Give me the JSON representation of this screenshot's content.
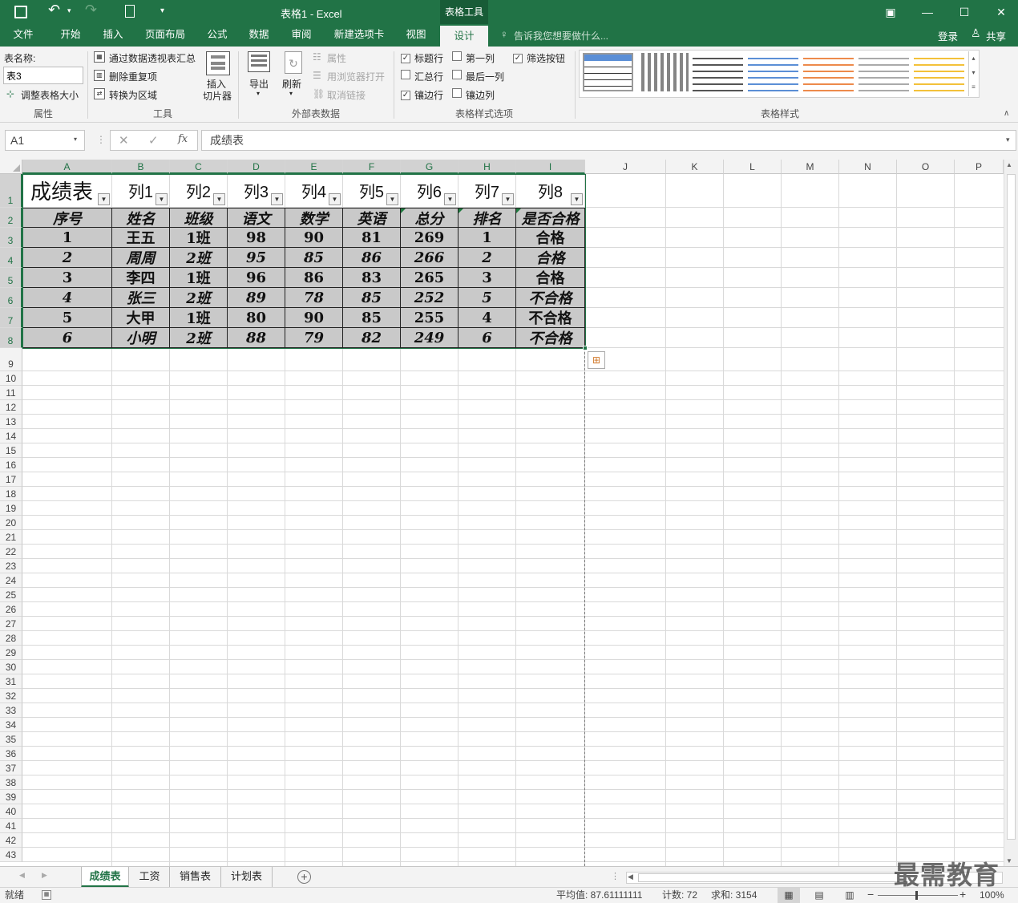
{
  "titlebar": {
    "title": "表格1 - Excel",
    "context_tab": "表格工具",
    "qat_more": "▾"
  },
  "tabs": [
    "文件",
    "开始",
    "插入",
    "页面布局",
    "公式",
    "数据",
    "审阅",
    "新建选项卡",
    "视图",
    "设计"
  ],
  "tell_me": "告诉我您想要做什么...",
  "account": {
    "login": "登录",
    "share": "共享"
  },
  "ribbon": {
    "table_name_label": "表名称:",
    "table_name_value": "表3",
    "resize_table": "调整表格大小",
    "group_properties": "属性",
    "summarize_pivot": "通过数据透视表汇总",
    "remove_duplicates": "删除重复项",
    "convert_to_range": "转换为区域",
    "insert_slicer_1": "插入",
    "insert_slicer_2": "切片器",
    "group_tools": "工具",
    "export": "导出",
    "refresh": "刷新",
    "properties": "属性",
    "open_browser": "用浏览器打开",
    "unlink": "取消链接",
    "group_external": "外部表数据",
    "opt_header_row": "标题行",
    "opt_total_row": "汇总行",
    "opt_banded_rows": "镶边行",
    "opt_first_col": "第一列",
    "opt_last_col": "最后一列",
    "opt_banded_cols": "镶边列",
    "opt_filter_btn": "筛选按钮",
    "group_style_options": "表格样式选项",
    "group_styles": "表格样式"
  },
  "formula": {
    "namebox": "A1",
    "fx": "fx",
    "value": "成绩表"
  },
  "columns": [
    "A",
    "B",
    "C",
    "D",
    "E",
    "F",
    "G",
    "H",
    "I",
    "J",
    "K",
    "L",
    "M",
    "N",
    "O",
    "P"
  ],
  "rows": [
    "1",
    "2",
    "3",
    "4",
    "5",
    "6",
    "7",
    "8",
    "9",
    "10",
    "11",
    "12",
    "13",
    "14",
    "15",
    "16",
    "17",
    "18",
    "19",
    "20",
    "21",
    "22",
    "23",
    "24",
    "25",
    "26",
    "27",
    "28",
    "29",
    "30",
    "31",
    "32",
    "33",
    "34",
    "35",
    "36",
    "37",
    "38",
    "39",
    "40",
    "41",
    "42",
    "43"
  ],
  "table": {
    "header_row": [
      "成绩表",
      "列1",
      "列2",
      "列3",
      "列4",
      "列5",
      "列6",
      "列7",
      "列8"
    ],
    "data": [
      [
        "序号",
        "姓名",
        "班级",
        "语文",
        "数学",
        "英语",
        "总分",
        "排名",
        "是否合格"
      ],
      [
        "1",
        "王五",
        "1班",
        "98",
        "90",
        "81",
        "269",
        "1",
        "合格"
      ],
      [
        "2",
        "周周",
        "2班",
        "95",
        "85",
        "86",
        "266",
        "2",
        "合格"
      ],
      [
        "3",
        "李四",
        "1班",
        "96",
        "86",
        "83",
        "265",
        "3",
        "合格"
      ],
      [
        "4",
        "张三",
        "2班",
        "89",
        "78",
        "85",
        "252",
        "5",
        "不合格"
      ],
      [
        "5",
        "大甲",
        "1班",
        "80",
        "90",
        "85",
        "255",
        "4",
        "不合格"
      ],
      [
        "6",
        "小明",
        "2班",
        "88",
        "79",
        "82",
        "249",
        "6",
        "不合格"
      ]
    ]
  },
  "sheets": [
    "成绩表",
    "工资",
    "销售表",
    "计划表"
  ],
  "status": {
    "ready": "就绪",
    "average": "平均值: 87.61111111",
    "count": "计数: 72",
    "sum": "求和: 3154",
    "zoom": "100%"
  },
  "watermark": "最需教育",
  "colors": {
    "excel_green": "#217346",
    "table_fill": "#c9c9c9"
  }
}
